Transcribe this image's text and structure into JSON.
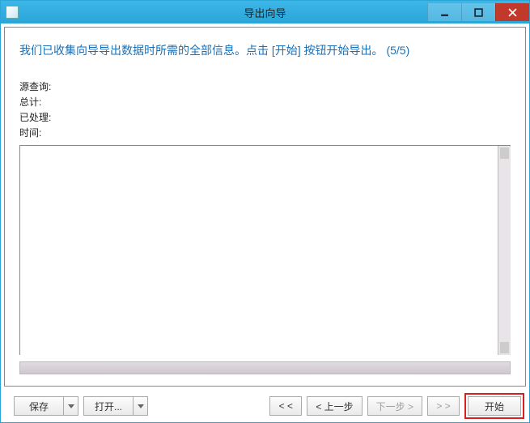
{
  "window": {
    "title": "导出向导"
  },
  "instruction": "我们已收集向导导出数据时所需的全部信息。点击 [开始] 按钮开始导出。  (5/5)",
  "fields": {
    "source_query": "源查询:",
    "total": "总计:",
    "processed": "已处理:",
    "time": "时间:"
  },
  "footer": {
    "save": "保存",
    "open": "打开...",
    "first": "< <",
    "prev": "< 上一步",
    "next": "下一步 >",
    "last": "> >",
    "start": "开始"
  }
}
